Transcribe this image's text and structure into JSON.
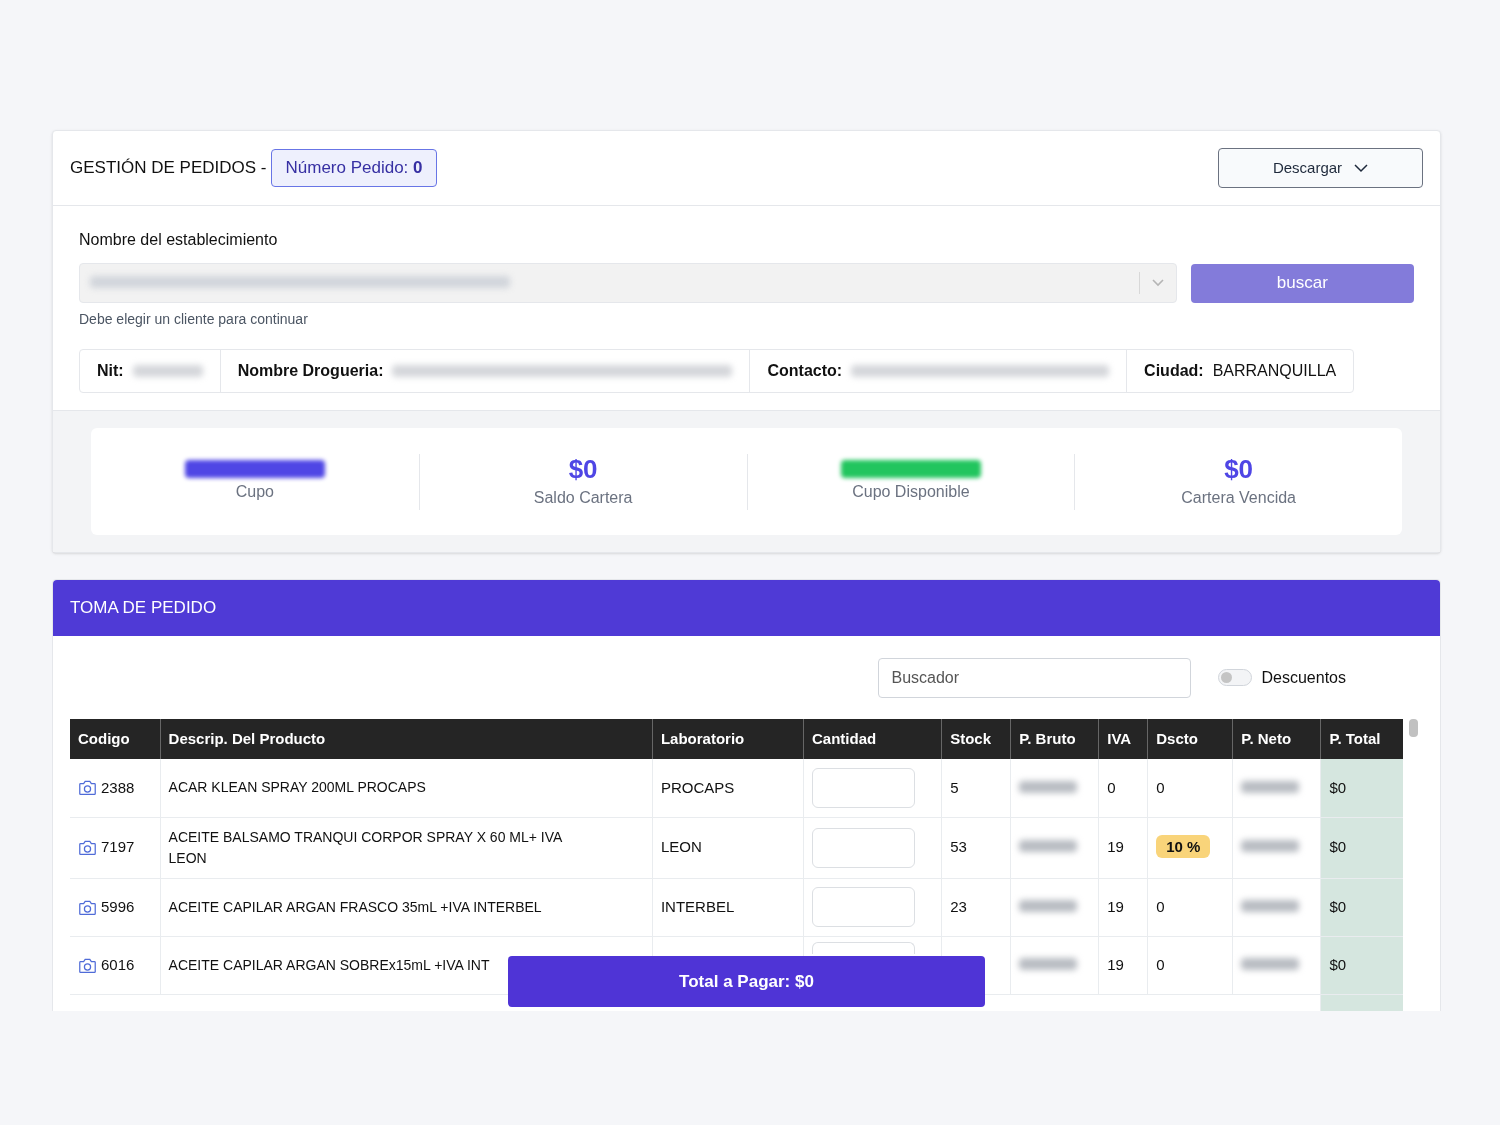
{
  "header": {
    "title": "GESTIÓN DE PEDIDOS -",
    "order_badge": "Número Pedido: **0**",
    "download_button": "Descargar"
  },
  "establishment": {
    "label": "Nombre del establecimiento",
    "select": {
      "redacted": true,
      "disabled": true
    },
    "search_button": {
      "label": "buscar",
      "disabled": true
    },
    "hint": "Debe elegir un cliente para continuar"
  },
  "info": [
    {
      "label": "Nit:",
      "redacted": true
    },
    {
      "label": "Nombre Drogueria:",
      "redacted": true
    },
    {
      "label": "Contacto:",
      "redacted": true
    },
    {
      "label": "Ciudad:",
      "value": "BARRANQUILLA",
      "redacted": false
    }
  ],
  "stats": [
    {
      "label": "Cupo",
      "redacted": true,
      "color": "#4f46e5"
    },
    {
      "label": "Saldo Cartera",
      "value": "$0",
      "redacted": false,
      "color": "#4f46e5"
    },
    {
      "label": "Cupo Disponible",
      "redacted": true,
      "color": "#22c55e"
    },
    {
      "label": "Cartera Vencida",
      "value": "$0",
      "redacted": false,
      "color": "#4f46e5"
    }
  ],
  "order": {
    "title": "TOMA DE PEDIDO",
    "search": {
      "placeholder": "Buscador"
    },
    "discounts": {
      "label": "Descuentos",
      "on": false
    }
  },
  "table": {
    "columns": [
      "Codigo",
      "Descrip. Del Producto",
      "Laboratorio",
      "Cantidad",
      "Stock",
      "P. Bruto",
      "IVA",
      "Dscto",
      "P. Neto",
      "P. Total"
    ],
    "rows": [
      {
        "code": "2388",
        "description": "ACAR KLEAN SPRAY 200ML PROCAPS",
        "lab": "PROCAPS",
        "stock": "5",
        "gross": {
          "redacted": true
        },
        "iva": "0",
        "discount": {
          "text": "0",
          "highlighted": false
        },
        "net": {
          "redacted": true
        },
        "total": "$0"
      },
      {
        "code": "7197",
        "description": "ACEITE BALSAMO TRANQUI CORPOR SPRAY X 60 ML+ IVA LEON",
        "lab": "LEON",
        "stock": "53",
        "gross": {
          "redacted": true
        },
        "iva": "19",
        "discount": {
          "text": "10 %",
          "highlighted": true
        },
        "net": {
          "redacted": true
        },
        "total": "$0"
      },
      {
        "code": "5996",
        "description": "ACEITE CAPILAR ARGAN FRASCO 35mL +IVA INTERBEL",
        "lab": "INTERBEL",
        "stock": "23",
        "gross": {
          "redacted": true
        },
        "iva": "19",
        "discount": {
          "text": "0",
          "highlighted": false
        },
        "net": {
          "redacted": true
        },
        "total": "$0"
      },
      {
        "code": "6016",
        "kind": "covered",
        "description": "ACEITE CAPILAR ARGAN SOBREx15mL +IVA INT",
        "gross": {
          "redacted": true
        },
        "iva": "19",
        "discount": {
          "text": "0",
          "highlighted": false
        },
        "net": {
          "redacted": true
        },
        "total": "$0"
      }
    ]
  },
  "total_button": "Total a Pagar: $0"
}
